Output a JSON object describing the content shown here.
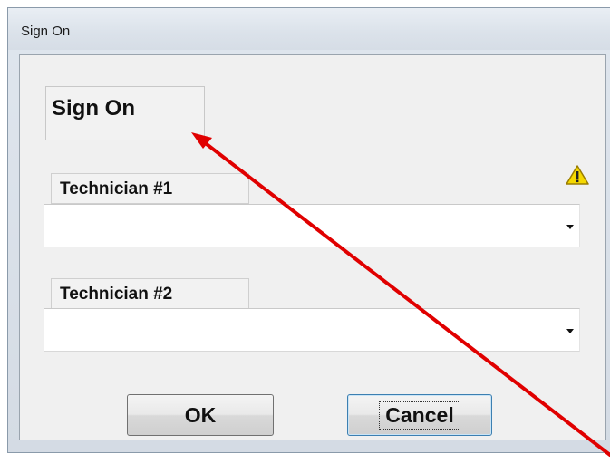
{
  "window": {
    "title": "Sign On"
  },
  "dialog": {
    "heading": "Sign On",
    "fields": [
      {
        "label": "Technician #1",
        "value": "",
        "has_warning": true
      },
      {
        "label": "Technician #2",
        "value": "",
        "has_warning": false
      }
    ],
    "buttons": {
      "ok_label": "OK",
      "cancel_label": "Cancel"
    }
  },
  "icons": {
    "dropdown": "chevron-down-icon",
    "warning": "warning-icon"
  },
  "colors": {
    "annotation_arrow": "#e00000",
    "warning_fill": "#f5d800",
    "focus_border": "#3c7fb1"
  }
}
